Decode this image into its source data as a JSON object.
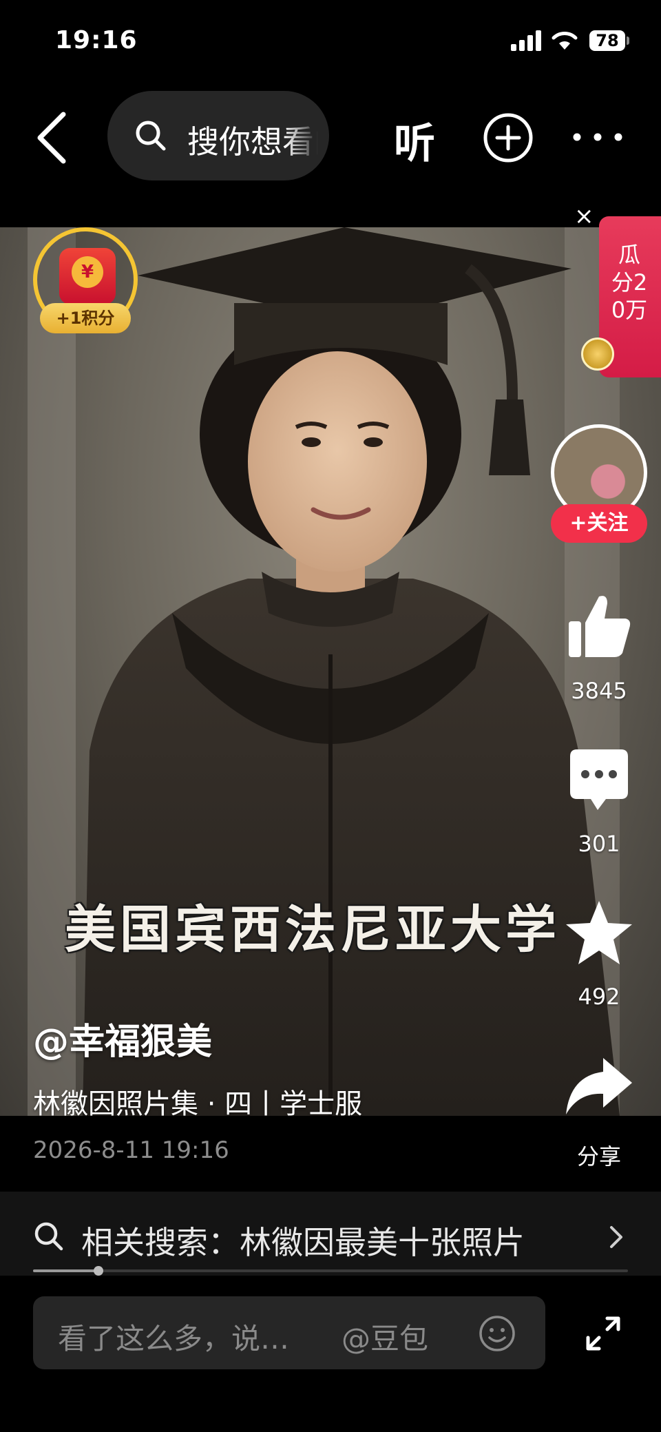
{
  "status_bar": {
    "time": "19:16",
    "battery": "78"
  },
  "top_nav": {
    "search_placeholder": "搜你想看的",
    "listen_label": "听"
  },
  "reward_badge": {
    "label": "+1积分",
    "coin_symbol": "¥"
  },
  "promo": {
    "text": "瓜分20万",
    "close": "×"
  },
  "author_panel": {
    "follow_label": "+关注"
  },
  "actions": {
    "likes": "3845",
    "comments": "301",
    "favorites": "492",
    "share_label": "分享"
  },
  "post": {
    "caption_overlay": "美国宾西法尼亚大学",
    "author": "@幸福狠美",
    "description": "林徽因照片集 · 四丨学士服",
    "timestamp": "2026-8-11 19:16"
  },
  "related_search": {
    "text": "相关搜索：林徽因最美十张照片",
    "progress": 0.11
  },
  "comment_bar": {
    "placeholder": "看了这么多，说…",
    "mention": "@豆包"
  },
  "icons": {
    "back": "chevron-left-icon",
    "search": "search-icon",
    "add": "plus-circle-icon",
    "more": "more-horizontal-icon",
    "like": "thumbs-up-icon",
    "comment": "comment-bubble-icon",
    "favorite": "star-icon",
    "share": "share-arrow-icon",
    "emoji": "emoji-icon",
    "expand": "expand-icon"
  },
  "colors": {
    "follow": "#f2304a",
    "promo": "#e02650",
    "coin_ring": "#f5c533"
  }
}
